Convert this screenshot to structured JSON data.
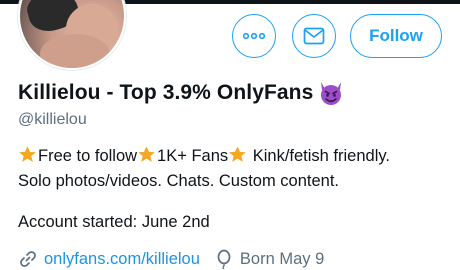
{
  "profile": {
    "display_name": "Killielou - Top 3.9% OnlyFans",
    "handle": "@killielou",
    "bio": {
      "line1_parts": [
        "Free to follow",
        "1K+ Fans",
        " Kink/fetish friendly."
      ],
      "line2": "Solo photos/videos. Chats. Custom content."
    },
    "account_started": "Account started: June 2nd",
    "link": "onlyfans.com/killielou",
    "born": "Born May 9"
  },
  "actions": {
    "follow_label": "Follow",
    "more_icon": "more-icon",
    "message_icon": "envelope-icon"
  },
  "icons": {
    "name_emoji": "smiling-devil-icon",
    "bio_emoji": "star-icon",
    "link": "link-icon",
    "born": "balloon-icon"
  },
  "colors": {
    "accent": "#1da1f2",
    "link": "#1b95e0",
    "secondary_text": "#5b7083",
    "primary_text": "#0f1419"
  }
}
